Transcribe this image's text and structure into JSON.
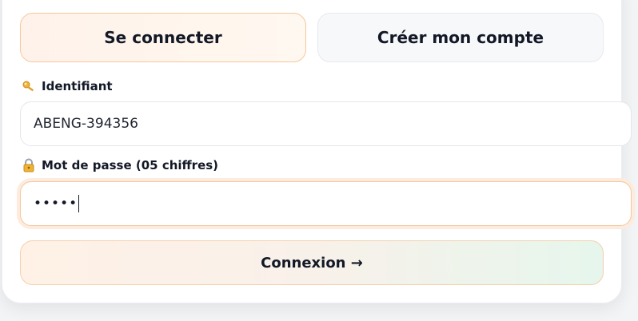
{
  "tabs": {
    "login_label": "Se connecter",
    "register_label": "Créer mon compte"
  },
  "identifier": {
    "label": "Identifiant",
    "icon": "key-icon",
    "value": "ABENG-394356"
  },
  "password": {
    "label": "Mot de passe (05 chiffres)",
    "icon": "lock-icon",
    "masked_value": "•••••"
  },
  "submit": {
    "label": "Connexion →"
  },
  "colors": {
    "accent_border": "#f5c89c",
    "focus_ring": "#fdebdd",
    "text": "#121826"
  }
}
